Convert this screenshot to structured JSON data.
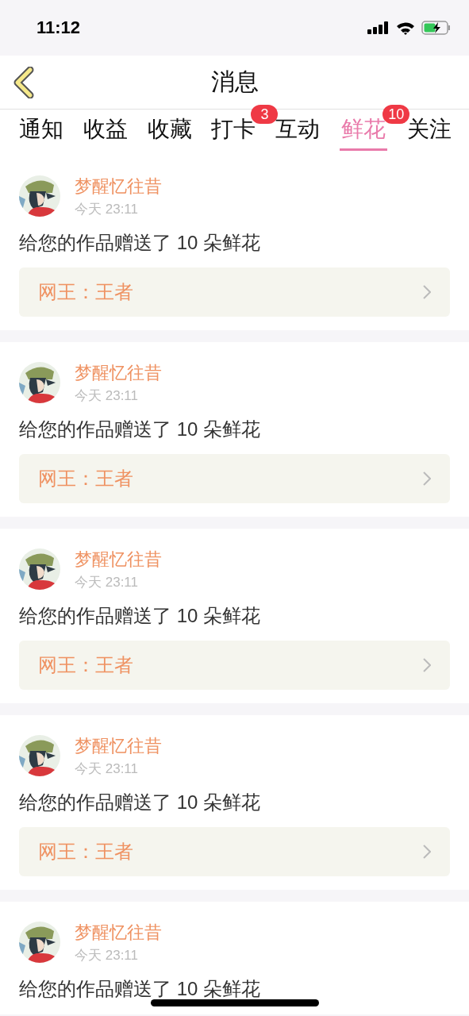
{
  "status_bar": {
    "time": "11:12"
  },
  "nav": {
    "title": "消息"
  },
  "tabs": [
    {
      "label": "通知",
      "selected": false
    },
    {
      "label": "收益",
      "selected": false
    },
    {
      "label": "收藏",
      "selected": false
    },
    {
      "label": "打卡",
      "selected": false,
      "badge": "3"
    },
    {
      "label": "互动",
      "selected": false
    },
    {
      "label": "鲜花",
      "selected": true,
      "badge": "10"
    },
    {
      "label": "关注",
      "selected": false
    }
  ],
  "messages": [
    {
      "name": "梦醒忆往昔",
      "time": "今天 23:11",
      "text": "给您的作品赠送了 10 朵鲜花",
      "link": "网王：王者"
    },
    {
      "name": "梦醒忆往昔",
      "time": "今天 23:11",
      "text": "给您的作品赠送了 10 朵鲜花",
      "link": "网王：王者"
    },
    {
      "name": "梦醒忆往昔",
      "time": "今天 23:11",
      "text": "给您的作品赠送了 10 朵鲜花",
      "link": "网王：王者"
    },
    {
      "name": "梦醒忆往昔",
      "time": "今天 23:11",
      "text": "给您的作品赠送了 10 朵鲜花",
      "link": "网王：王者"
    },
    {
      "name": "梦醒忆往昔",
      "time": "今天 23:11",
      "text": "给您的作品赠送了 10 朵鲜花"
    }
  ]
}
